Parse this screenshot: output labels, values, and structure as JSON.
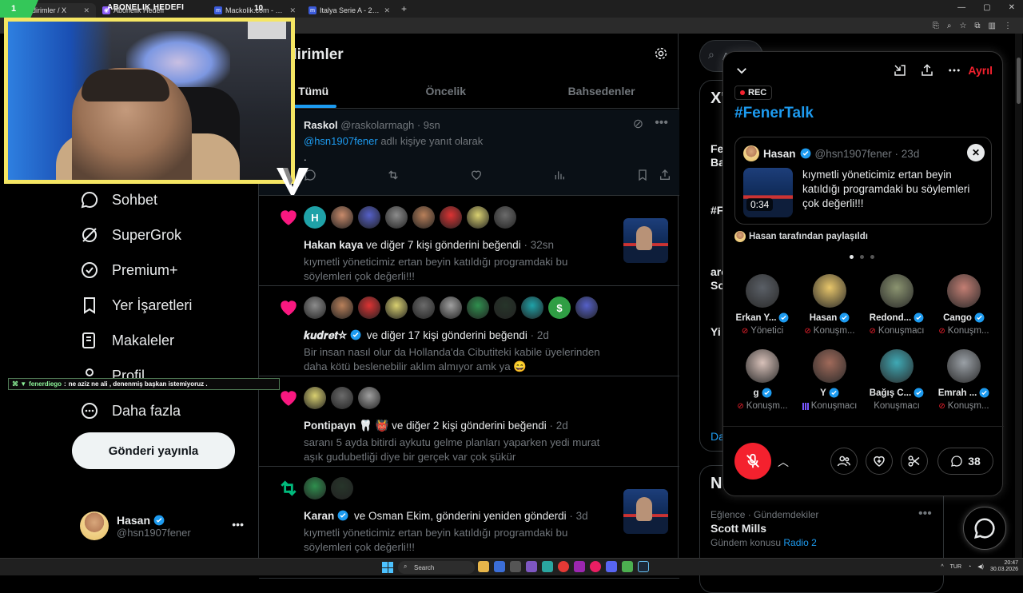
{
  "browser": {
    "tabs": [
      {
        "label": "dirimler / X",
        "icon": "x-logo"
      },
      {
        "label": "Abonelik Hedefi",
        "icon": "stream-icon"
      },
      {
        "label": "Mackolik.com - Canlı maç",
        "icon": "m-logo"
      },
      {
        "label": "Italya Serie A - 2025/2026 - Pu",
        "icon": "m-logo"
      }
    ],
    "new_tab": "+"
  },
  "stream_overlay": {
    "goal_left": "1",
    "goal_title": "ABONELIK HEDEFI",
    "goal_right": "10",
    "chat_user": "fenerdiego",
    "chat_message": "ne aziz ne ali , denenmiş başkan istemiyoruz ."
  },
  "sidebar": {
    "items": [
      {
        "label": "Sohbet",
        "icon": "chat-icon"
      },
      {
        "label": "SuperGrok",
        "icon": "grok-icon"
      },
      {
        "label": "Premium+",
        "icon": "verified-icon"
      },
      {
        "label": "Yer İşaretleri",
        "icon": "bookmark-icon"
      },
      {
        "label": "Makaleler",
        "icon": "article-icon"
      },
      {
        "label": "Profil",
        "icon": "profile-icon"
      },
      {
        "label": "Daha fazla",
        "icon": "more-icon"
      }
    ],
    "post_button": "Gönderi yayınla",
    "account": {
      "name": "Hasan",
      "handle": "@hsn1907fener",
      "more": "•••"
    }
  },
  "feed": {
    "title": "dirimler",
    "tabs": [
      "Tümü",
      "Öncelik",
      "Bahsedenler"
    ],
    "active_tab": "Tümü",
    "reply": {
      "name": "Raskol",
      "handle": "@raskolarmagh",
      "time": "· 9sn",
      "reply_prefix": "@hsn1907fener",
      "reply_suffix": " adlı kişiye yanıt olarak",
      "text": "."
    },
    "notifications": [
      {
        "kind": "like",
        "faces": [
          "H",
          "",
          "",
          "",
          "",
          "",
          "",
          ""
        ],
        "actor": "Hakan kaya",
        "action": " ve diğer 7 kişi gönderini beğendi",
        "time": " · 32sn",
        "body": "kıymetli yöneticimiz ertan beyin katıldığı programdaki bu söylemleri çok değerli!!!",
        "thumb": true
      },
      {
        "kind": "like",
        "faces": [
          "",
          "",
          "",
          "",
          "",
          "",
          "",
          "",
          "",
          "$",
          ""
        ],
        "actor": "𝒌𝒖𝒅𝒓𝒆𝒕☆",
        "action": " ve diğer 17 kişi gönderini beğendi",
        "time": " · 2d",
        "body": "Bir insan nasıl olur da Hollanda'da Cibutiteki kabile üyelerinden daha kötü beslenebilir aklım almıyor amk ya 😄",
        "thumb": false
      },
      {
        "kind": "like",
        "faces": [
          "",
          "",
          ""
        ],
        "actor": "Pontipayn 🦷 👹",
        "action": " ve diğer 2 kişi gönderini beğendi",
        "time": " · 2d",
        "body": "saranı 5 ayda bitirdi aykutu gelme planları yaparken yedi murat aşık gudubetliği diye bir gerçek var çok şükür",
        "thumb": false
      },
      {
        "kind": "repost",
        "faces": [
          "",
          ""
        ],
        "actor": "Karan",
        "action": " ve Osman Ekim, gönderini yeniden gönderdi",
        "time": " · 3d",
        "body": "kıymetli yöneticimiz ertan beyin katıldığı programdaki bu söylemleri çok değerli!!!",
        "thumb": true
      }
    ]
  },
  "right": {
    "search_placeholder": "A",
    "trend_heading": "X'",
    "t2": "Fe",
    "t3": "Ba",
    "t4": "#F",
    "t5": "arc",
    "t6": "So",
    "t7": "Yi",
    "t8": "Da",
    "news_heading": "Ne",
    "news_category": "Eğlence · Gündemdekiler",
    "news_name": "Scott Mills",
    "news_sub_prefix": "Gündem konusu ",
    "news_sub_link": "Radio 2",
    "news_more": "•••"
  },
  "space": {
    "leave": "Ayrıl",
    "rec": "REC",
    "title": "#FenerTalk",
    "pinned": {
      "name": "Hasan",
      "handle": "@hsn1907fener · 23d",
      "duration": "0:34",
      "text": "kıymetli yöneticimiz ertan beyin katıldığı programdaki bu söylemleri çok değerli!!!"
    },
    "shared_by": "Hasan tarafından paylaşıldı",
    "speakers": [
      {
        "name": "Erkan Y...",
        "role": "Yönetici",
        "status": "muted"
      },
      {
        "name": "Hasan",
        "role": "Konuşm...",
        "status": "muted"
      },
      {
        "name": "Redond...",
        "role": "Konuşmacı",
        "status": "muted"
      },
      {
        "name": "Cango",
        "role": "Konuşm...",
        "status": "muted"
      },
      {
        "name": "g",
        "role": "Konuşm...",
        "status": "muted"
      },
      {
        "name": "Y",
        "role": "Konuşmacı",
        "status": "speaking"
      },
      {
        "name": "Bağış C...",
        "role": "Konuşmacı",
        "status": "none"
      },
      {
        "name": "Emrah ...",
        "role": "Konuşm...",
        "status": "muted"
      }
    ],
    "comments": "38"
  },
  "taskbar": {
    "search": "Search",
    "lang": "TUR",
    "time": "20:47",
    "date": "30.03.2026"
  },
  "colors": {
    "accent": "#1d9bf0",
    "like": "#f91880",
    "repost": "#00ba7c",
    "danger": "#f4212e",
    "overlay": "#f5e663"
  }
}
